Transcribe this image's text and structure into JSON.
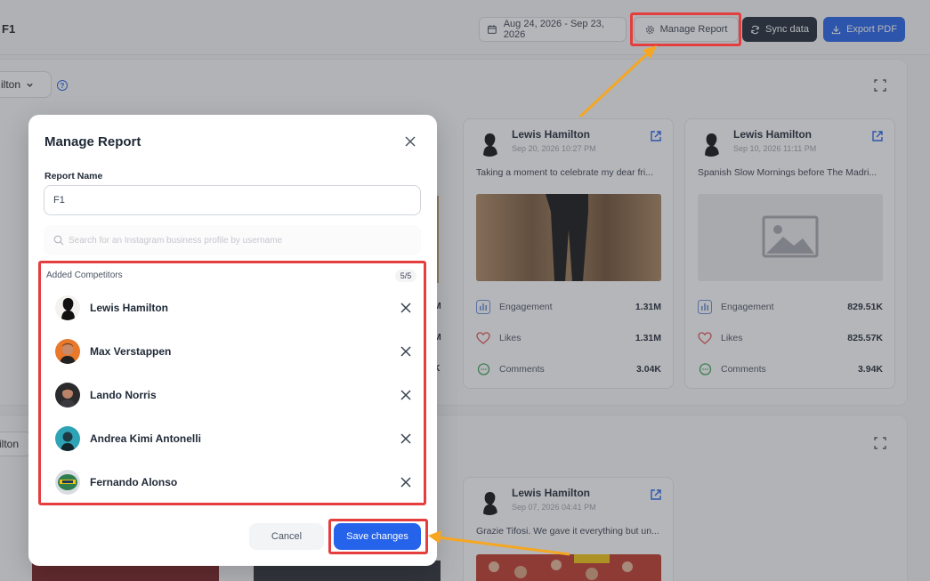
{
  "header": {
    "report_title": "F1",
    "date_range": "Aug 24, 2026 - Sep 23, 2026",
    "manage_label": "Manage Report",
    "sync_label": "Sync data",
    "export_label": "Export PDF"
  },
  "section1": {
    "selector_label": "ilton"
  },
  "section2": {
    "selector_label": "ilton"
  },
  "posts": [
    {
      "name": "Lewis Hamilton",
      "date": "Sep 20, 2026 10:27 PM",
      "text": "Taking a moment to celebrate my dear fri...",
      "engagement_label": "Engagement",
      "engagement": "1.31M",
      "likes_label": "Likes",
      "likes": "1.31M",
      "comments_label": "Comments",
      "comments": "3.04K"
    },
    {
      "name": "Lewis Hamilton",
      "date": "Sep 10, 2026 11:11 PM",
      "text": "Spanish Slow Mornings before The Madri...",
      "engagement_label": "Engagement",
      "engagement": "829.51K",
      "likes_label": "Likes",
      "likes": "825.57K",
      "comments_label": "Comments",
      "comments": "3.94K"
    },
    {
      "name": "Lewis Hamilton",
      "date": "Sep 07, 2026 04:41 PM",
      "text": "Grazie Tifosi. We gave it everything but un..."
    }
  ],
  "partial_values": {
    "left_m1": "M",
    "left_m2": "M",
    "left_k": "K"
  },
  "modal": {
    "title": "Manage Report",
    "name_label": "Report Name",
    "name_value": "F1",
    "search_placeholder": "Search for an Instagram business profile by username",
    "competitors_label": "Added Competitors",
    "competitors_count": "5/5",
    "competitors": [
      {
        "name": "Lewis Hamilton"
      },
      {
        "name": "Max Verstappen"
      },
      {
        "name": "Lando Norris"
      },
      {
        "name": "Andrea Kimi Antonelli"
      },
      {
        "name": "Fernando Alonso"
      }
    ],
    "cancel_label": "Cancel",
    "save_label": "Save changes"
  },
  "colors": {
    "primary": "#2563eb",
    "highlight": "#e53e3e",
    "arrow": "#f5a623"
  }
}
